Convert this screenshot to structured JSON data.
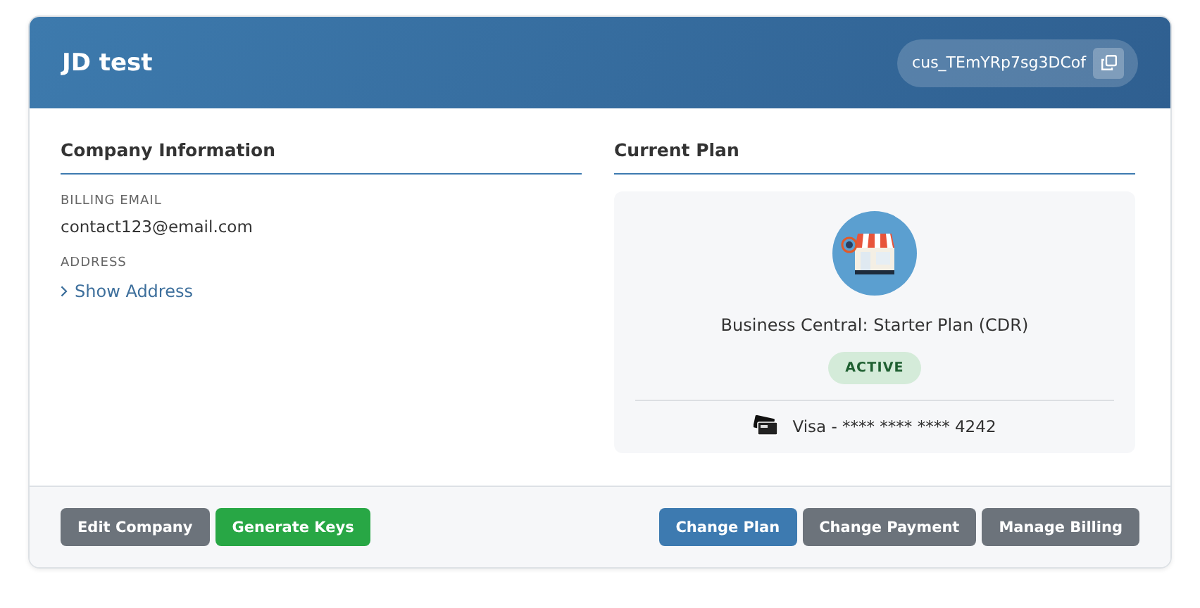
{
  "header": {
    "title": "JD test",
    "customer_id": "cus_TEmYRp7sg3DCof"
  },
  "company_information": {
    "heading": "Company Information",
    "fields": [
      {
        "label": "BILLING EMAIL",
        "kind": "text",
        "value": "contact123@email.com"
      },
      {
        "label": "ADDRESS",
        "kind": "toggle",
        "value": "Show Address",
        "expanded": false
      }
    ]
  },
  "current_plan": {
    "heading": "Current Plan",
    "plan_name": "Business Central: Starter Plan (CDR)",
    "status": "ACTIVE",
    "payment_method": "Visa - **** **** **** 4242"
  },
  "footer": {
    "left_buttons": [
      {
        "label": "Edit Company",
        "kind": "secondary"
      },
      {
        "label": "Generate Keys",
        "kind": "success"
      }
    ],
    "right_buttons": [
      {
        "label": "Change Plan",
        "kind": "primary"
      },
      {
        "label": "Change Payment",
        "kind": "secondary"
      },
      {
        "label": "Manage Billing",
        "kind": "secondary"
      }
    ]
  }
}
